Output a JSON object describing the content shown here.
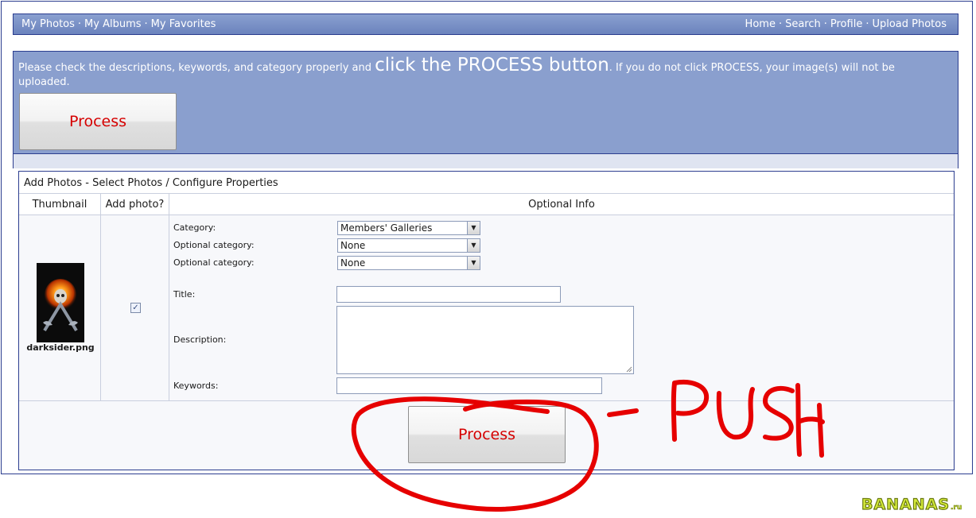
{
  "nav": {
    "left": [
      "My Photos",
      "My Albums",
      "My Favorites"
    ],
    "right": [
      "Home",
      "Search",
      "Profile",
      "Upload Photos"
    ],
    "separator": "·"
  },
  "notice": {
    "before": "Please check the descriptions, keywords, and category properly and ",
    "emphasis": "click the PROCESS button",
    "after": ". If you do not click PROCESS, your image(s) will not be uploaded."
  },
  "process_label": "Process",
  "panel": {
    "title": "Add Photos - Select Photos / Configure Properties",
    "columns": [
      "Thumbnail",
      "Add photo?",
      "Optional Info"
    ],
    "filename": "darksider.png",
    "add_photo_checked": true,
    "fields": {
      "category_label": "Category:",
      "category_value": "Members' Galleries",
      "optional_category_label": "Optional category:",
      "optional_category_1": "None",
      "optional_category_2": "None",
      "title_label": "Title:",
      "description_label": "Description:",
      "keywords_label": "Keywords:"
    }
  },
  "annotation": {
    "text": "PUSH",
    "color": "#e60000"
  },
  "logo": {
    "text": "BANANAS",
    "suffix": ".ru"
  }
}
